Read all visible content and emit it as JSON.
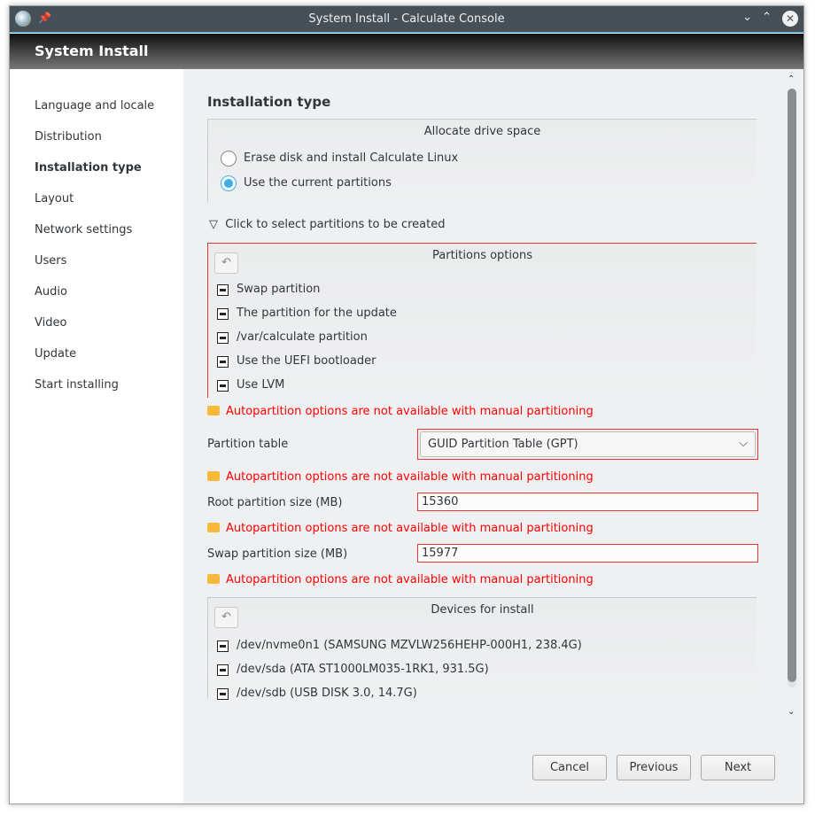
{
  "window": {
    "title": "System Install - Calculate Console",
    "header": "System Install"
  },
  "sidebar": {
    "items": [
      {
        "label": "Language and locale"
      },
      {
        "label": "Distribution"
      },
      {
        "label": "Installation type",
        "active": true
      },
      {
        "label": "Layout"
      },
      {
        "label": "Network settings"
      },
      {
        "label": "Users"
      },
      {
        "label": "Audio"
      },
      {
        "label": "Video"
      },
      {
        "label": "Update"
      },
      {
        "label": "Start installing"
      }
    ]
  },
  "main": {
    "title": "Installation type",
    "allocate": {
      "title": "Allocate drive space",
      "options": [
        {
          "label": "Erase disk and install Calculate Linux",
          "selected": false
        },
        {
          "label": "Use the current partitions",
          "selected": true
        }
      ]
    },
    "expander": {
      "icon": "triangle-down-icon",
      "label": "Click to select partitions to be created"
    },
    "partitions": {
      "title": "Partitions options",
      "items": [
        {
          "label": "Swap partition"
        },
        {
          "label": "The partition for the update"
        },
        {
          "label": "/var/calculate partition"
        },
        {
          "label": "Use the UEFI bootloader"
        },
        {
          "label": "Use LVM"
        }
      ]
    },
    "warning": "Autopartition options are not available with manual partitioning",
    "partition_table": {
      "label": "Partition table",
      "value": "GUID Partition Table (GPT)"
    },
    "root_size": {
      "label": "Root partition size (MB)",
      "value": "15360"
    },
    "swap_size": {
      "label": "Swap partition size (MB)",
      "value": "15977"
    },
    "devices": {
      "title": "Devices for install",
      "items": [
        {
          "label": "/dev/nvme0n1 (SAMSUNG MZVLW256HEHP-000H1, 238.4G)"
        },
        {
          "label": "/dev/sda (ATA ST1000LM035-1RK1, 931.5G)"
        },
        {
          "label": "/dev/sdb (USB DISK 3.0, 14.7G)"
        }
      ]
    },
    "buttons": {
      "cancel": "Cancel",
      "previous": "Previous",
      "next": "Next"
    }
  },
  "colors": {
    "accent": "#3daee9",
    "error": "#ff0000",
    "warning_icon": "#f6b93b"
  }
}
